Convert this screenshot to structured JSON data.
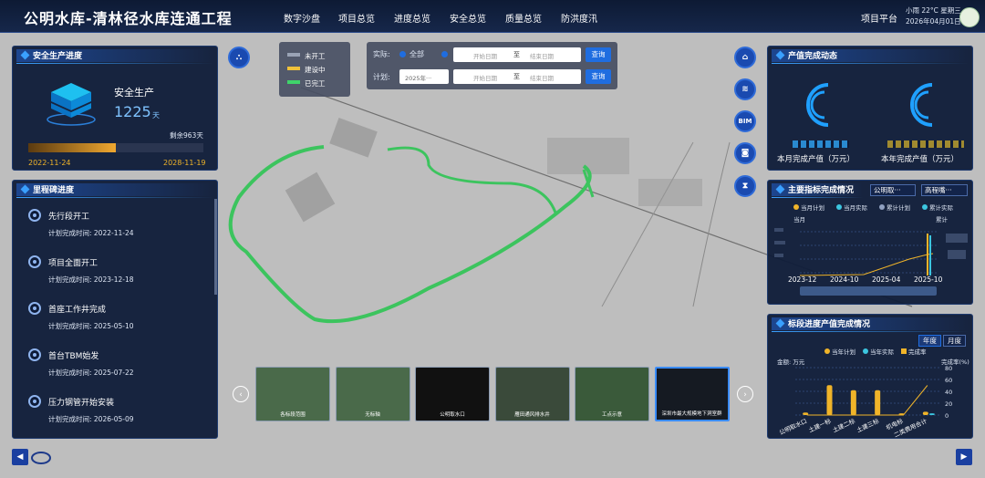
{
  "header": {
    "title": "公明水库-清林径水库连通工程",
    "nav": [
      "数字沙盘",
      "项目总览",
      "进度总览",
      "安全总览",
      "质量总览",
      "防洪度汛"
    ],
    "platform": "项目平台",
    "weather": "小雨 22°C 星期三",
    "date": "2026年04月01日"
  },
  "safety": {
    "title": "安全生产进度",
    "label": "安全生产",
    "days": "1225",
    "unit": "天",
    "remaining": "剩余963天",
    "start": "2022-11-24",
    "end": "2028-11-19",
    "progress": 0.5
  },
  "milestones": {
    "title": "里程碑进度",
    "items": [
      {
        "name": "先行段开工",
        "plan": "计划完成时间: 2022-11-24"
      },
      {
        "name": "项目全面开工",
        "plan": "计划完成时间: 2023-12-18"
      },
      {
        "name": "首座工作井完成",
        "plan": "计划完成时间: 2025-05-10"
      },
      {
        "name": "首台TBM始发",
        "plan": "计划完成时间: 2025-07-22"
      },
      {
        "name": "压力钢管开始安装",
        "plan": "计划完成时间: 2026-05-09"
      }
    ]
  },
  "legend": {
    "items": [
      {
        "label": "未开工",
        "color": "#9aa3b5"
      },
      {
        "label": "建设中",
        "color": "#f0c23a"
      },
      {
        "label": "已完工",
        "color": "#3fd36a"
      }
    ]
  },
  "filter": {
    "actual_label": "实际:",
    "all_label": "全部",
    "start_placeholder": "开始日期",
    "to": "至",
    "end_placeholder": "结束日期",
    "query": "查询",
    "plan_label": "计划:",
    "plan_year": "2025年···"
  },
  "side_buttons": {
    "bim": "BIM"
  },
  "thumbnails": [
    "各标段范围",
    "无标轴",
    "公明取水口",
    "雁田通风排水井",
    "工点示意",
    "深圳市最大规模地下洞室群"
  ],
  "output_value": {
    "title": "产值完成动态",
    "month_label": "本月完成产值（万元）",
    "year_label": "本年完成产值（万元）"
  },
  "indicators": {
    "title": "主要指标完成情况",
    "select1": "公明取···",
    "select2": "高程嘴···",
    "legend": [
      "当月计划",
      "当月实际",
      "累计计划",
      "累计实际"
    ],
    "left_unit": "当月",
    "right_unit": "累计",
    "x_ticks": [
      "2023-12",
      "2024-10",
      "2025-04",
      "2025-10"
    ]
  },
  "sections": {
    "title": "标段进度产值完成情况",
    "tab_year": "年度",
    "tab_month": "月度",
    "legend": [
      "当年计划",
      "当年实际",
      "完成率"
    ],
    "amount_label": "金额: 万元",
    "rate_label": "完成率(%)",
    "right_ticks": [
      "80",
      "60",
      "40",
      "20",
      "0"
    ]
  },
  "chart_data": {
    "type": "bar",
    "categories": [
      "公明取水口",
      "土建一标",
      "土建二标",
      "土建三标",
      "机电标",
      "二类费用合计"
    ],
    "series": [
      {
        "name": "当年计划",
        "values": [
          3,
          36,
          30,
          30,
          2,
          4
        ]
      },
      {
        "name": "当年实际",
        "values": [
          0,
          0,
          0,
          0,
          0,
          2
        ]
      },
      {
        "name": "完成率",
        "values": [
          0,
          0,
          0,
          0,
          0,
          50
        ]
      }
    ],
    "ylim": [
      0,
      80
    ]
  },
  "colors": {
    "panel": "#0e1b38",
    "accent": "#3aa0ff",
    "green": "#3fd36a",
    "gold": "#f0b429",
    "cyan": "#3cc6e0"
  }
}
